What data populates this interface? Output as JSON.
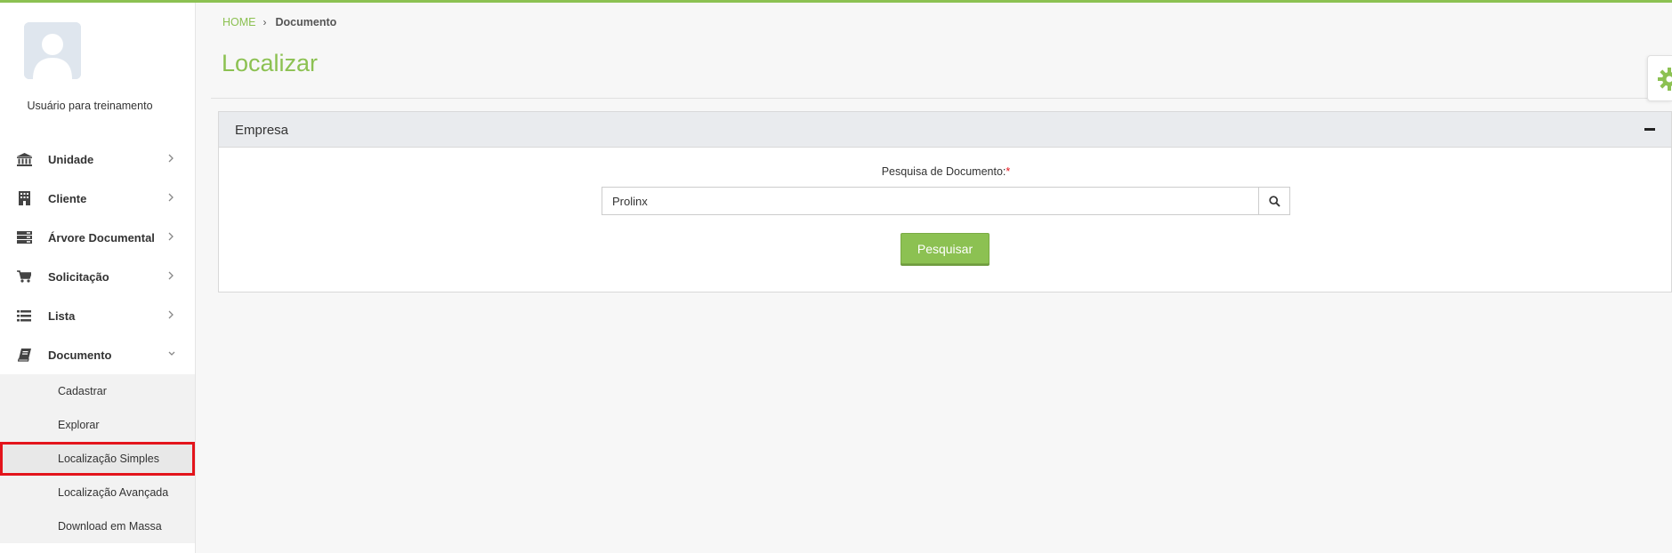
{
  "colors": {
    "accent": "#8cc152",
    "required": "#e3141b",
    "highlight_box": "#e3141b"
  },
  "user": {
    "name": "Usuário para treinamento",
    "avatar_icon": "user-silhouette-icon"
  },
  "sidebar": {
    "items": [
      {
        "label": "Unidade",
        "icon": "bank-icon"
      },
      {
        "label": "Cliente",
        "icon": "building-icon"
      },
      {
        "label": "Árvore Documental",
        "icon": "server-icon"
      },
      {
        "label": "Solicitação",
        "icon": "cart-icon"
      },
      {
        "label": "Lista",
        "icon": "list-icon"
      },
      {
        "label": "Documento",
        "icon": "book-icon",
        "expanded": true
      }
    ],
    "submenu": [
      {
        "label": "Cadastrar"
      },
      {
        "label": "Explorar"
      },
      {
        "label": "Localização Simples",
        "active": true
      },
      {
        "label": "Localização Avançada"
      },
      {
        "label": "Download em Massa"
      }
    ]
  },
  "breadcrumb": {
    "home": "HOME",
    "separator": "›",
    "current": "Documento"
  },
  "page": {
    "title": "Localizar"
  },
  "panel": {
    "title": "Empresa",
    "field_label": "Pesquisa de Documento:",
    "required_mark": "*",
    "search_value": "Prolinx",
    "submit_label": "Pesquisar"
  }
}
